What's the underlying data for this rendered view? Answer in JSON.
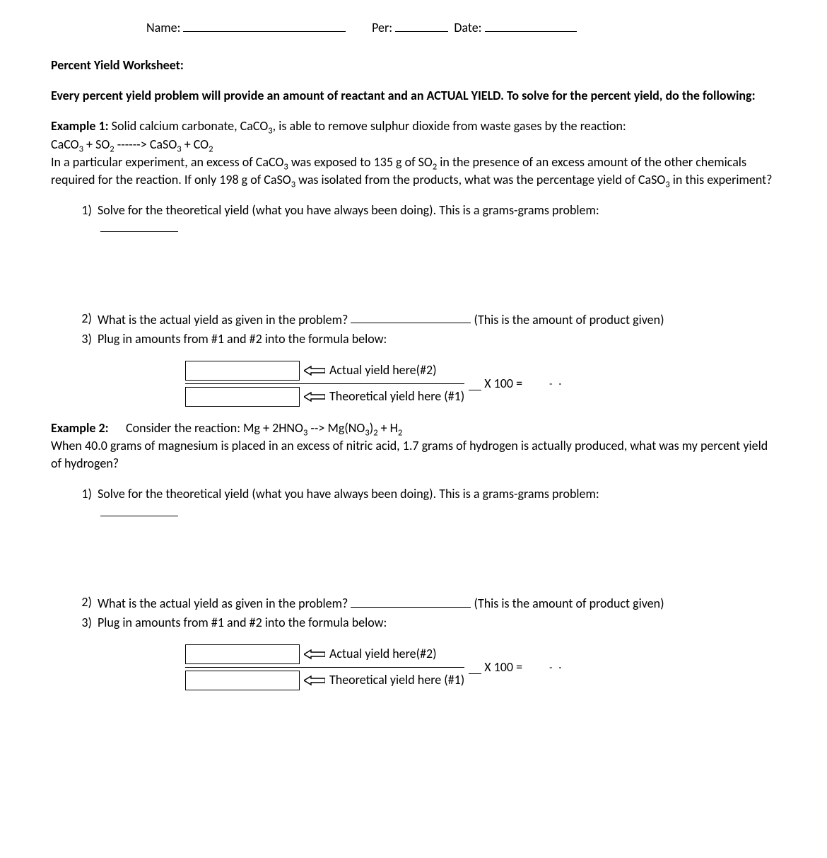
{
  "header": {
    "name_label": "Name:",
    "per_label": "Per:",
    "date_label": "Date:"
  },
  "title": "Percent Yield Worksheet:",
  "intro": "Every percent yield problem will provide an amount of reactant and an ACTUAL YIELD.  To solve for the percent yield, do the following:",
  "ex1": {
    "label": "Example 1:",
    "line1_a": " Solid calcium carbonate, CaCO",
    "line1_b": ", is able to remove sulphur dioxide from waste gases by the reaction:",
    "eq_a": "CaCO",
    "eq_b": "  +  SO",
    "eq_c": " ------>  CaSO",
    "eq_d": " + CO",
    "line3_a": "In a particular experiment, an excess of CaCO",
    "line3_b": " was exposed to 135 g of SO",
    "line3_c": " in the presence of an excess amount of the other chemicals required for the reaction. If only 198 g of CaSO",
    "line3_d": " was isolated from the products, what was the percentage yield of CaSO",
    "line3_e": " in this experiment?"
  },
  "steps": {
    "n1": "1)",
    "s1": "Solve for the theoretical yield (what you have always been doing).  This is a grams-grams problem:",
    "n2": "2)",
    "s2a": "What is the actual yield as given in the problem? ",
    "s2b": " (This is the amount of product given)",
    "n3": "3)",
    "s3": "Plug in amounts from #1 and #2 into the formula below:"
  },
  "formula": {
    "top": "Actual yield here(#2)",
    "bottom": "Theoretical yield here (#1)",
    "mult": "X 100 =",
    "dots": "- ·"
  },
  "ex2": {
    "label": "Example 2:",
    "line1_a": "Consider the reaction: Mg + 2HNO",
    "line1_b": " --> Mg(NO",
    "line1_c": ")",
    "line1_d": " + H",
    "line2": "When 40.0 grams of magnesium is placed in an excess of nitric acid, 1.7 grams of hydrogen is actually produced, what was my percent yield of hydrogen?"
  }
}
